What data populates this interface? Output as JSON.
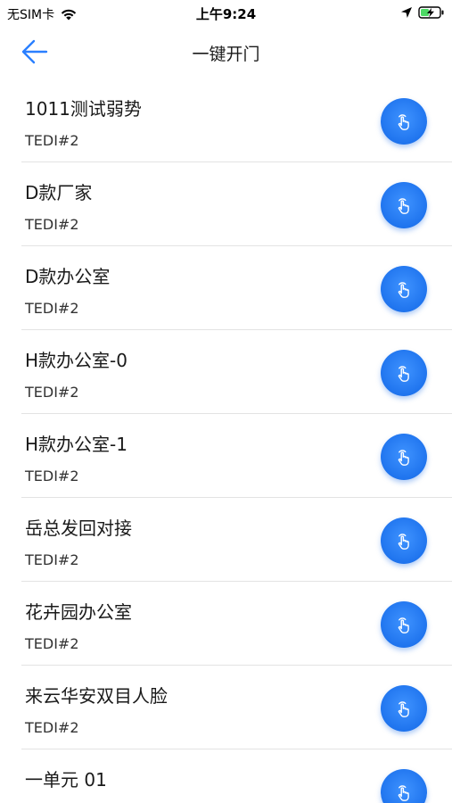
{
  "status_bar": {
    "carrier": "无SIM卡",
    "time": "上午9:24",
    "wifi_icon": "wifi-icon",
    "location_icon": "location-arrow-icon",
    "battery_icon": "battery-charging-icon"
  },
  "nav": {
    "title": "一键开门",
    "back_icon": "back-arrow-icon"
  },
  "colors": {
    "accent": "#2a7fff",
    "button_blue": "#1f74ee",
    "divider": "#e3e3e3"
  },
  "doors": [
    {
      "name": "1011测试弱势",
      "sub": "TEDI#2",
      "action_icon": "tap-finger-icon"
    },
    {
      "name": "D款厂家",
      "sub": "TEDI#2",
      "action_icon": "tap-finger-icon"
    },
    {
      "name": "D款办公室",
      "sub": "TEDI#2",
      "action_icon": "tap-finger-icon"
    },
    {
      "name": "H款办公室-0",
      "sub": "TEDI#2",
      "action_icon": "tap-finger-icon"
    },
    {
      "name": "H款办公室-1",
      "sub": "TEDI#2",
      "action_icon": "tap-finger-icon"
    },
    {
      "name": "岳总发回对接",
      "sub": "TEDI#2",
      "action_icon": "tap-finger-icon"
    },
    {
      "name": "花卉园办公室",
      "sub": "TEDI#2",
      "action_icon": "tap-finger-icon"
    },
    {
      "name": "来云华安双目人脸",
      "sub": "TEDI#2",
      "action_icon": "tap-finger-icon"
    },
    {
      "name": "一单元 01",
      "sub": "",
      "action_icon": "tap-finger-icon"
    }
  ]
}
